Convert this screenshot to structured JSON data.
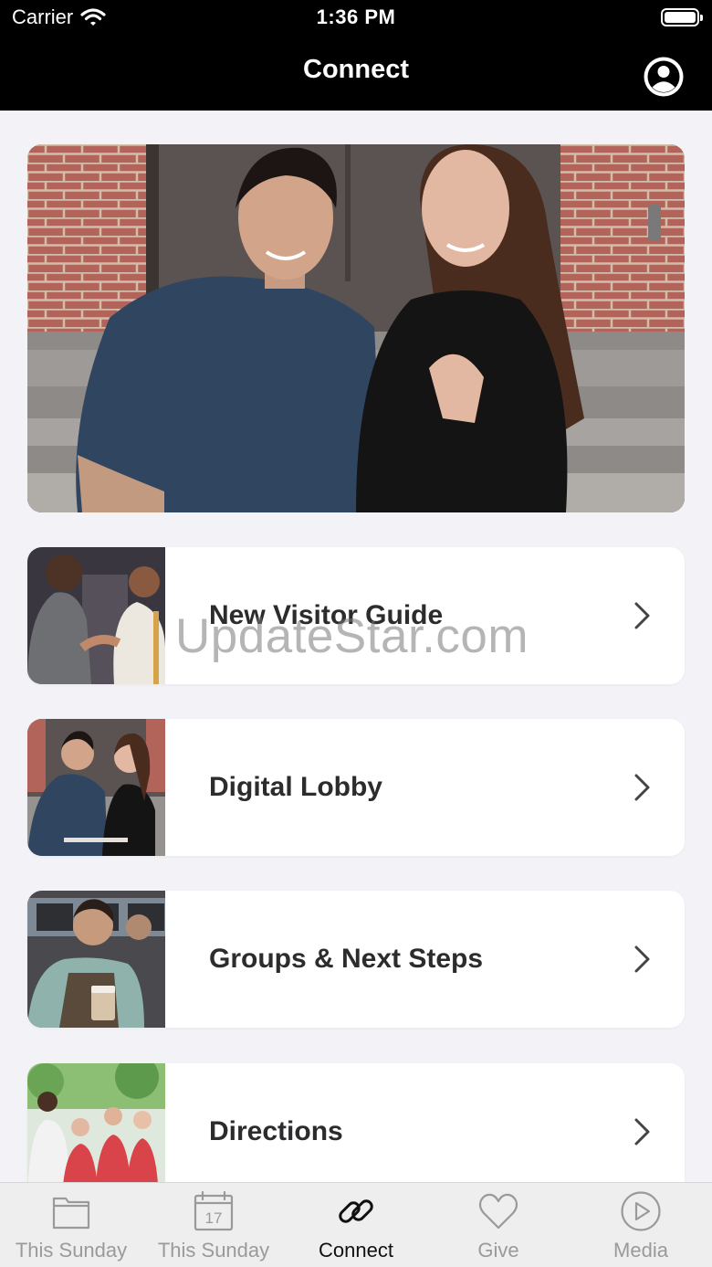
{
  "status_bar": {
    "carrier": "Carrier",
    "time": "1:36 PM"
  },
  "nav": {
    "title": "Connect",
    "profile_icon": "person-circle-icon"
  },
  "hero": {
    "image": "photo-couple-sitting-on-steps"
  },
  "menu": [
    {
      "label": "New Visitor Guide",
      "thumb": "photo-handshake",
      "chevron": "chevron-right-icon"
    },
    {
      "label": "Digital Lobby",
      "thumb": "photo-couple",
      "chevron": "chevron-right-icon"
    },
    {
      "label": "Groups & Next Steps",
      "thumb": "photo-barista-coffee",
      "chevron": "chevron-right-icon"
    },
    {
      "label": "Directions",
      "thumb": "photo-volunteers-group",
      "chevron": "chevron-right-icon"
    }
  ],
  "watermark": "UpdateStar.com",
  "tabs": [
    {
      "label": "This Sunday",
      "icon": "folder-icon",
      "active": false
    },
    {
      "label": "This Sunday",
      "icon": "calendar-icon",
      "calendar_day": "17",
      "active": false
    },
    {
      "label": "Connect",
      "icon": "link-icon",
      "active": true
    },
    {
      "label": "Give",
      "icon": "heart-icon",
      "active": false
    },
    {
      "label": "Media",
      "icon": "play-circle-icon",
      "active": false
    }
  ],
  "colors": {
    "nav_bg": "#000000",
    "page_bg": "#f2f2f7",
    "card_bg": "#ffffff",
    "tab_inactive": "#9a9a9a",
    "tab_active": "#111111"
  }
}
